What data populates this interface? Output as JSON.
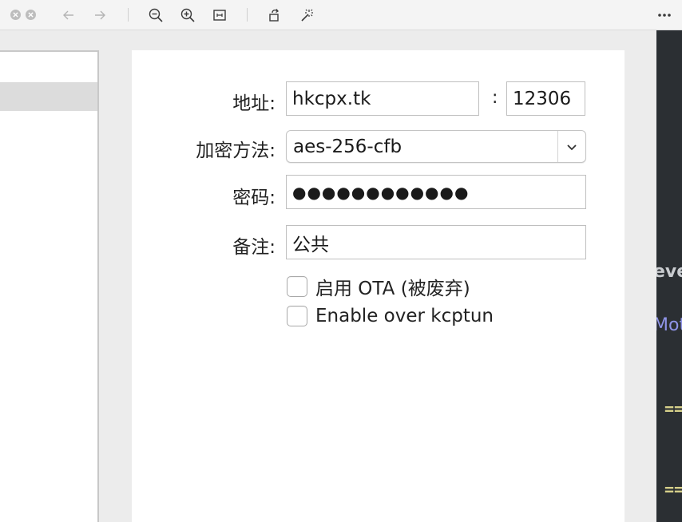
{
  "toolbar": {
    "buttons": [
      {
        "name": "close-window",
        "icon": "close-icon"
      },
      {
        "name": "minimize-window",
        "icon": "close-icon"
      },
      {
        "name": "back",
        "icon": "arrow-left-icon",
        "enabled": false
      },
      {
        "name": "forward",
        "icon": "arrow-right-icon",
        "enabled": false
      },
      {
        "name": "zoom-out",
        "icon": "zoom-out-icon"
      },
      {
        "name": "zoom-in",
        "icon": "zoom-in-icon"
      },
      {
        "name": "fit-to-window",
        "icon": "fit-icon"
      },
      {
        "name": "rotate",
        "icon": "rotate-icon"
      },
      {
        "name": "enhance",
        "icon": "magic-wand-icon"
      },
      {
        "name": "more",
        "icon": "more-icon"
      }
    ]
  },
  "form": {
    "address_label": "地址:",
    "address_value": "hkcpx.tk",
    "port_separator": ":",
    "port_value": "12306",
    "encryption_label": "加密方法:",
    "encryption_value": "aes-256-cfb",
    "password_label": "密码:",
    "password_value": "●●●●●●●●●●●●",
    "remark_label": "备注:",
    "remark_value": "公共",
    "ota_checkbox_label": "启用 OTA (被废弃)",
    "ota_checked": false,
    "kcptun_checkbox_label": "Enable over kcptun",
    "kcptun_checked": false
  },
  "background_window": {
    "text_1": "eve",
    "text_2": "Mot",
    "text_3": "==",
    "text_4": "==",
    "colors": {
      "background": "#2b2f33",
      "keyword": "#8f94e8",
      "operator": "#d6d08a"
    }
  }
}
